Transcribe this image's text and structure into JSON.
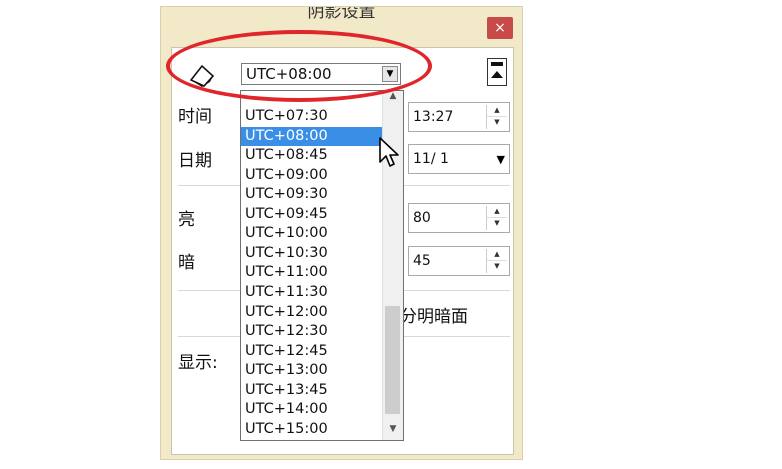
{
  "window": {
    "title": "阴影设置",
    "close_label": "×"
  },
  "timezone": {
    "value": "UTC+08:00",
    "options": [
      "UTC+07:30",
      "UTC+08:00",
      "UTC+08:45",
      "UTC+09:00",
      "UTC+09:30",
      "UTC+09:45",
      "UTC+10:00",
      "UTC+10:30",
      "UTC+11:00",
      "UTC+11:30",
      "UTC+12:00",
      "UTC+12:30",
      "UTC+12:45",
      "UTC+13:00",
      "UTC+13:45",
      "UTC+14:00",
      "UTC+15:00"
    ],
    "selected_index": 1
  },
  "fields": {
    "time_label": "时间",
    "time_value": "13:27",
    "date_label": "日期",
    "date_value": "11/ 1",
    "light_label": "亮",
    "light_value": "80",
    "dark_label": "暗",
    "dark_value": "45",
    "sun_shading_label": "分明暗面",
    "display_label": "显示:"
  },
  "colors": {
    "highlight": "#e0252b",
    "selection": "#3a8ee6",
    "close_button": "#c94b49",
    "window_bg": "#f2e9c9"
  },
  "icons": [
    "shadow-icon",
    "collapse-icon",
    "close-icon",
    "chevron-down-icon",
    "mouse-cursor-icon"
  ]
}
